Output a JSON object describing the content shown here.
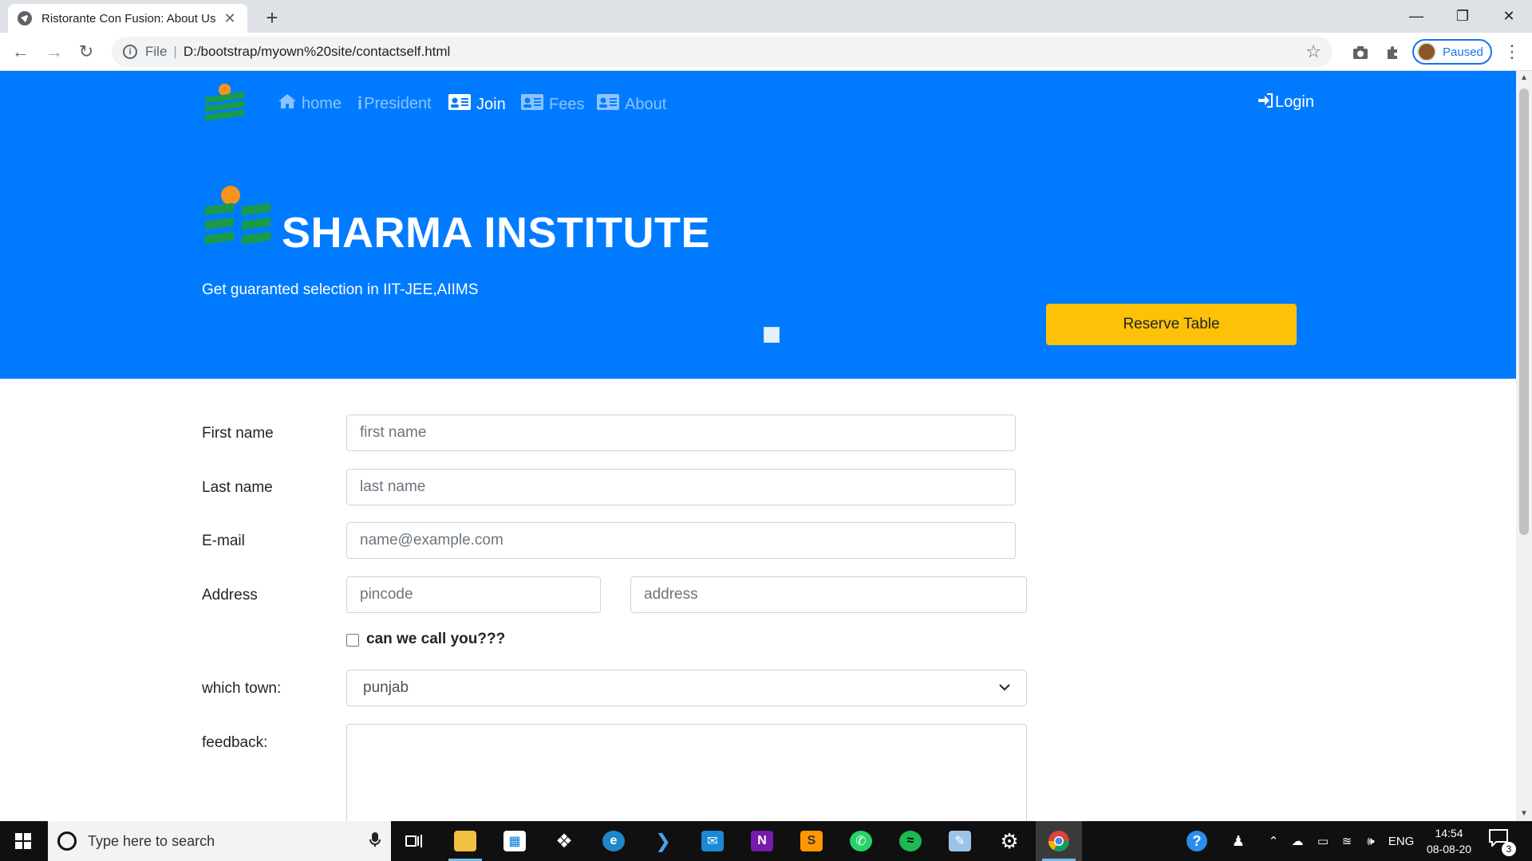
{
  "browser": {
    "tab_title": "Ristorante Con Fusion: About Us",
    "new_tab": "+",
    "url_scheme": "File",
    "url": "D:/bootstrap/myown%20site/contactself.html",
    "profile_status": "Paused"
  },
  "navbar": {
    "links": [
      {
        "label": "home",
        "icon": "home-icon"
      },
      {
        "label": "President",
        "icon": "info-icon"
      },
      {
        "label": "Join",
        "icon": "id-card-icon",
        "active": true
      },
      {
        "label": "Fees",
        "icon": "id-card-icon"
      },
      {
        "label": "About",
        "icon": "id-card-icon"
      }
    ],
    "login_label": "Login"
  },
  "jumbotron": {
    "title": "SHARMA INSTITUTE",
    "tagline": "Get guaranted selection in IIT-JEE,AIIMS",
    "reserve_label": "Reserve Table"
  },
  "form": {
    "first_name_label": "First name",
    "first_name_placeholder": "first name",
    "last_name_label": "Last name",
    "last_name_placeholder": "last name",
    "email_label": "E-mail",
    "email_placeholder": "name@example.com",
    "address_label": "Address",
    "pincode_placeholder": "pincode",
    "address_placeholder": "address",
    "call_label": "can we call you???",
    "town_label": "which town:",
    "town_selected": "punjab",
    "feedback_label": "feedback:"
  },
  "taskbar": {
    "search_placeholder": "Type here to search",
    "language": "ENG",
    "time": "14:54",
    "date": "08-08-20",
    "notification_count": "3"
  },
  "colors": {
    "primary": "#007bff",
    "warning": "#ffc107",
    "logo_orange": "#f7931e",
    "logo_green": "#1a9a4a"
  }
}
